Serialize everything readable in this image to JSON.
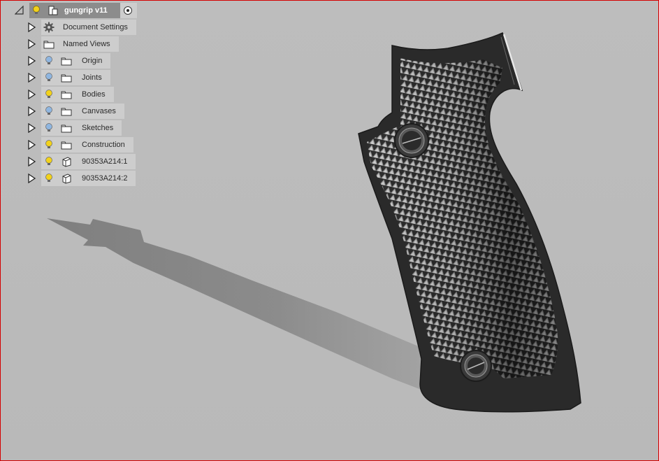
{
  "browser": {
    "root": {
      "label": "gungrip v11",
      "light": "on"
    },
    "items": [
      {
        "label": "Document Settings",
        "icon": "gear-icon",
        "light": "none"
      },
      {
        "label": "Named Views",
        "icon": "folder-icon",
        "light": "none"
      },
      {
        "label": "Origin",
        "icon": "folder-icon",
        "light": "off"
      },
      {
        "label": "Joints",
        "icon": "folder-icon",
        "light": "off"
      },
      {
        "label": "Bodies",
        "icon": "folder-icon",
        "light": "on"
      },
      {
        "label": "Canvases",
        "icon": "folder-icon",
        "light": "off"
      },
      {
        "label": "Sketches",
        "icon": "folder-icon",
        "light": "off"
      },
      {
        "label": "Construction",
        "icon": "folder-icon",
        "light": "on"
      },
      {
        "label": "90353A214:1",
        "icon": "component-icon",
        "light": "on"
      },
      {
        "label": "90353A214:2",
        "icon": "component-icon",
        "light": "on"
      }
    ]
  },
  "colors": {
    "viewport_background": "#bcbcbc",
    "border": "#d40000",
    "bulb_on": "#f2d21b",
    "bulb_off": "#8fb6e0",
    "grip": "#2c2c2c"
  }
}
